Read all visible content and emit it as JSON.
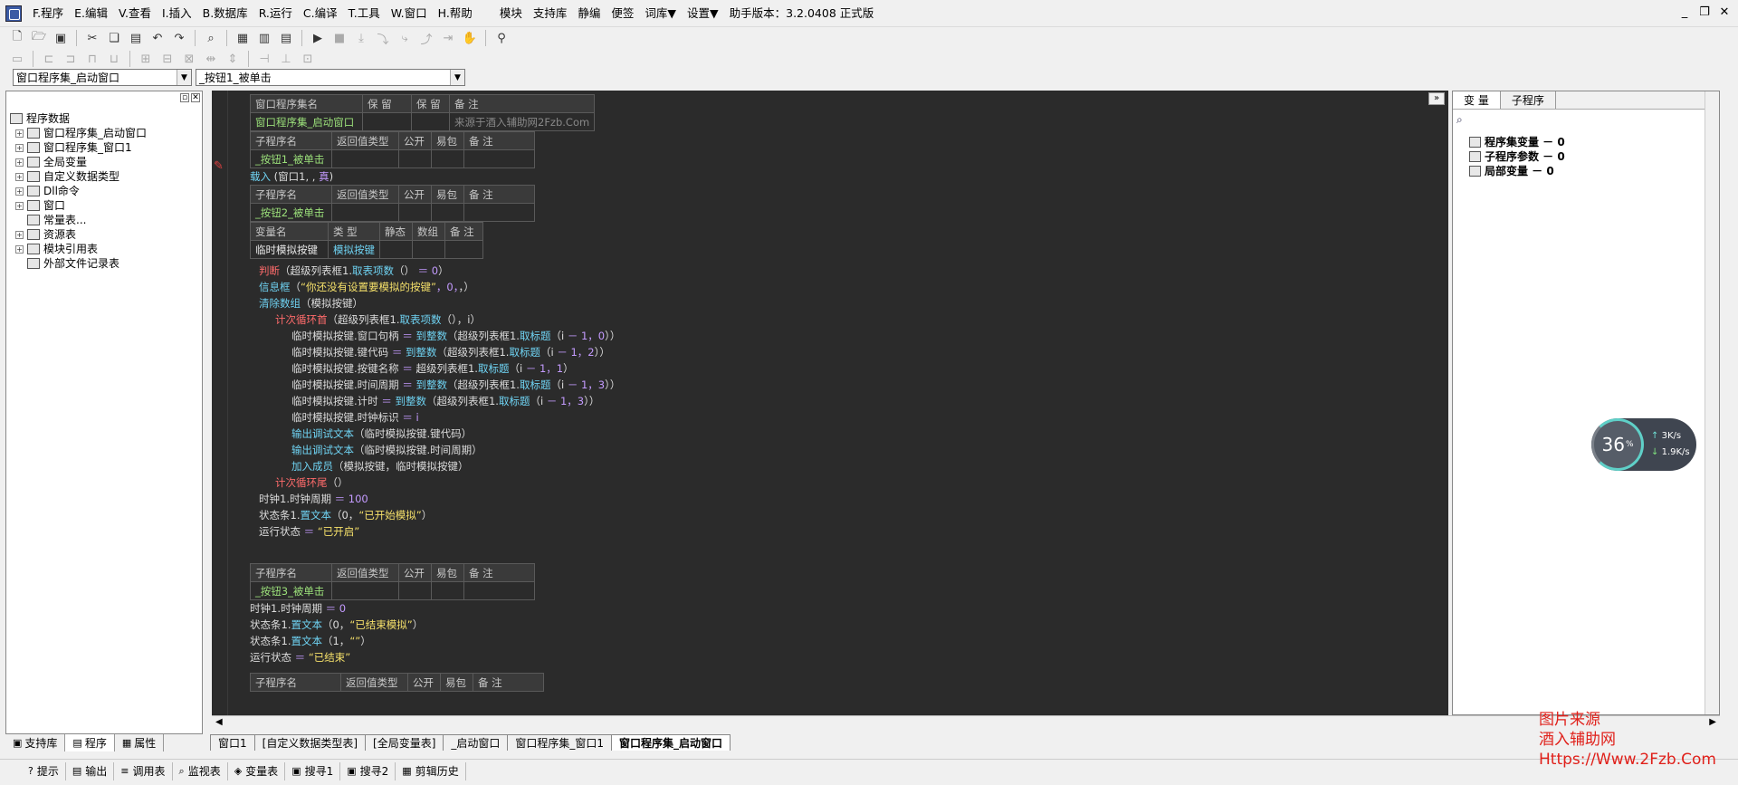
{
  "menu": {
    "items": [
      "F.程序",
      "E.编辑",
      "V.查看",
      "I.插入",
      "B.数据库",
      "R.运行",
      "C.编译",
      "T.工具",
      "W.窗口",
      "H.帮助"
    ],
    "extra": [
      "模块",
      "支持库",
      "静编",
      "便签",
      "词库▼",
      "设置▼"
    ],
    "version": "助手版本：3.2.0408 正式版"
  },
  "icons": {
    "app": "app-icon",
    "new": "new-file-icon",
    "open": "open-folder-icon",
    "save": "save-icon",
    "cut": "cut-icon",
    "copy": "copy-icon",
    "paste": "paste-icon",
    "undo": "undo-icon",
    "redo": "redo-icon",
    "run": "run-icon",
    "stop": "stop-icon"
  },
  "combos": {
    "left": "窗口程序集_启动窗口",
    "right": "_按钮1_被单击"
  },
  "tree": {
    "root": "程序数据",
    "items": [
      "窗口程序集_启动窗口",
      "窗口程序集_窗口1",
      "全局变量",
      "自定义数据类型",
      "Dll命令",
      "窗口",
      "常量表...",
      "资源表",
      "模块引用表",
      "外部文件记录表"
    ]
  },
  "left_tabs": [
    "支持库",
    "程序",
    "属性"
  ],
  "code": {
    "asm_header": [
      "窗口程序集名",
      "保 留",
      "保 留",
      "备 注"
    ],
    "asm_row": [
      "窗口程序集_启动窗口",
      "",
      "",
      "来源于酒入辅助网2Fzb.Com"
    ],
    "sub_header": [
      "子程序名",
      "返回值类型",
      "公开",
      "易包",
      "备 注"
    ],
    "sub1": "_按钮1_被单击",
    "line_load": [
      "载入",
      "(窗口1, , ",
      "真",
      ")"
    ],
    "sub2": "_按钮2_被单击",
    "var_header": [
      "变量名",
      "类 型",
      "静态",
      "数组",
      "备 注"
    ],
    "var_row": [
      "临时模拟按键",
      "模拟按键"
    ],
    "lines": [
      {
        "i": 0,
        "t": [
          [
            "kw",
            "判断"
          ],
          [
            "",
            "（超级列表框1."
          ],
          [
            "fn",
            "取表项数"
          ],
          [
            "",
            "（）"
          ],
          [
            "num",
            " ＝ 0"
          ],
          [
            "",
            "）"
          ]
        ]
      },
      {
        "i": 0,
        "t": [
          [
            "fn",
            "信息框"
          ],
          [
            "",
            "（"
          ],
          [
            "str",
            "“你还没有设置要模拟的按键”"
          ],
          [
            "num",
            "，0，"
          ],
          [
            "",
            "，）"
          ]
        ]
      },
      {
        "i": 0,
        "t": [
          [
            "fn",
            "清除数组"
          ],
          [
            "",
            "（模拟按键）"
          ]
        ]
      },
      {
        "i": 1,
        "t": [
          [
            "kw",
            "计次循环首"
          ],
          [
            "",
            "（超级列表框1."
          ],
          [
            "fn",
            "取表项数"
          ],
          [
            "",
            "（），i）"
          ]
        ]
      },
      {
        "i": 2,
        "t": [
          [
            "",
            "临时模拟按键.窗口句柄 "
          ],
          [
            "num",
            "＝ "
          ],
          [
            "fn",
            "到整数"
          ],
          [
            "",
            "（超级列表框1."
          ],
          [
            "fn",
            "取标题"
          ],
          [
            "",
            "（i "
          ],
          [
            "num",
            "－ 1，0"
          ],
          [
            "",
            "））"
          ]
        ]
      },
      {
        "i": 2,
        "t": [
          [
            "",
            "临时模拟按键.键代码 "
          ],
          [
            "num",
            "＝ "
          ],
          [
            "fn",
            "到整数"
          ],
          [
            "",
            "（超级列表框1."
          ],
          [
            "fn",
            "取标题"
          ],
          [
            "",
            "（i "
          ],
          [
            "num",
            "－ 1，2"
          ],
          [
            "",
            "））"
          ]
        ]
      },
      {
        "i": 2,
        "t": [
          [
            "",
            "临时模拟按键.按键名称 "
          ],
          [
            "num",
            "＝ "
          ],
          [
            "",
            "超级列表框1."
          ],
          [
            "fn",
            "取标题"
          ],
          [
            "",
            "（i "
          ],
          [
            "num",
            "－ 1，1"
          ],
          [
            "",
            "）"
          ]
        ]
      },
      {
        "i": 2,
        "t": [
          [
            "",
            "临时模拟按键.时间周期 "
          ],
          [
            "num",
            "＝ "
          ],
          [
            "fn",
            "到整数"
          ],
          [
            "",
            "（超级列表框1."
          ],
          [
            "fn",
            "取标题"
          ],
          [
            "",
            "（i "
          ],
          [
            "num",
            "－ 1，3"
          ],
          [
            "",
            "））"
          ]
        ]
      },
      {
        "i": 2,
        "t": [
          [
            "",
            "临时模拟按键.计时 "
          ],
          [
            "num",
            "＝ "
          ],
          [
            "fn",
            "到整数"
          ],
          [
            "",
            "（超级列表框1."
          ],
          [
            "fn",
            "取标题"
          ],
          [
            "",
            "（i "
          ],
          [
            "num",
            "－ 1，3"
          ],
          [
            "",
            "））"
          ]
        ]
      },
      {
        "i": 2,
        "t": [
          [
            "",
            "临时模拟按键.时钟标识 "
          ],
          [
            "num",
            "＝ i"
          ]
        ]
      },
      {
        "i": 2,
        "t": [
          [
            "fn",
            "输出调试文本"
          ],
          [
            "",
            "（临时模拟按键.键代码）"
          ]
        ]
      },
      {
        "i": 2,
        "t": [
          [
            "fn",
            "输出调试文本"
          ],
          [
            "",
            "（临时模拟按键.时间周期）"
          ]
        ]
      },
      {
        "i": 2,
        "t": [
          [
            "fn",
            "加入成员"
          ],
          [
            "",
            "（模拟按键，临时模拟按键）"
          ]
        ]
      },
      {
        "i": 1,
        "t": [
          [
            "kw",
            "计次循环尾"
          ],
          [
            "",
            "（）"
          ]
        ]
      },
      {
        "i": 0,
        "t": [
          [
            "",
            "时钟1.时钟周期 "
          ],
          [
            "num",
            "＝ 100"
          ]
        ]
      },
      {
        "i": 0,
        "t": [
          [
            "",
            "状态条1."
          ],
          [
            "fn",
            "置文本"
          ],
          [
            "",
            "（0，"
          ],
          [
            "str",
            "“已开始模拟”"
          ],
          [
            "",
            "）"
          ]
        ]
      },
      {
        "i": 0,
        "t": [
          [
            "",
            "运行状态 "
          ],
          [
            "num",
            "＝ "
          ],
          [
            "str",
            "“已开启”"
          ]
        ]
      }
    ],
    "sub3": "_按钮3_被单击",
    "lines3": [
      {
        "t": [
          [
            "",
            "时钟1.时钟周期 "
          ],
          [
            "num",
            "＝ 0"
          ]
        ]
      },
      {
        "t": [
          [
            "",
            "状态条1."
          ],
          [
            "fn",
            "置文本"
          ],
          [
            "",
            "（0，"
          ],
          [
            "str",
            "“已结束模拟”"
          ],
          [
            "",
            "）"
          ]
        ]
      },
      {
        "t": [
          [
            "",
            "状态条1."
          ],
          [
            "fn",
            "置文本"
          ],
          [
            "",
            "（1，"
          ],
          [
            "str",
            "“”"
          ],
          [
            "",
            "）"
          ]
        ]
      },
      {
        "t": [
          [
            "",
            "运行状态 "
          ],
          [
            "num",
            "＝ "
          ],
          [
            "str",
            "“已结束”"
          ]
        ]
      }
    ]
  },
  "right_panel": {
    "tabs": [
      "变 量",
      "子程序"
    ],
    "items": [
      "程序集变量 － 0",
      "子程序参数 － 0",
      "局部变量 － 0"
    ]
  },
  "widget": {
    "percent": "36",
    "unit": "%",
    "up": "3K/s",
    "down": "1.9K/s"
  },
  "doc_tabs": [
    "窗口1",
    "[自定义数据类型表]",
    "[全局变量表]",
    "_启动窗口",
    "窗口程序集_窗口1",
    "窗口程序集_启动窗口"
  ],
  "bottom": [
    "提示",
    "输出",
    "调用表",
    "监视表",
    "变量表",
    "搜寻1",
    "搜寻2",
    "剪辑历史"
  ],
  "watermark": [
    "图片来源",
    "酒入辅助网",
    "Https://Www.2Fzb.Com"
  ]
}
